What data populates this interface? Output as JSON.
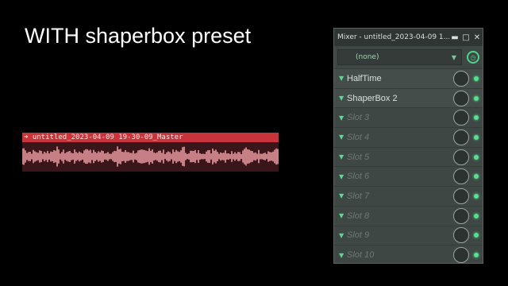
{
  "caption": "WITH shaperbox preset",
  "clip": {
    "title": "untitled_2023-04-09 19-30-09_Master",
    "header_color": "#c8343a",
    "wave_color": "#f4a3a8"
  },
  "mixer": {
    "title": "Mixer - untitled_2023-04-09 1...",
    "controls": {
      "minimize": "▬",
      "maximize": "□",
      "close": "✕"
    },
    "preset": "(none)",
    "accent": "#56e08f",
    "slots": [
      {
        "name": "HalfTime",
        "filled": true
      },
      {
        "name": "ShaperBox 2",
        "filled": true
      },
      {
        "name": "Slot 3",
        "filled": false
      },
      {
        "name": "Slot 4",
        "filled": false
      },
      {
        "name": "Slot 5",
        "filled": false
      },
      {
        "name": "Slot 6",
        "filled": false
      },
      {
        "name": "Slot 7",
        "filled": false
      },
      {
        "name": "Slot 8",
        "filled": false
      },
      {
        "name": "Slot 9",
        "filled": false
      },
      {
        "name": "Slot 10",
        "filled": false
      }
    ]
  }
}
